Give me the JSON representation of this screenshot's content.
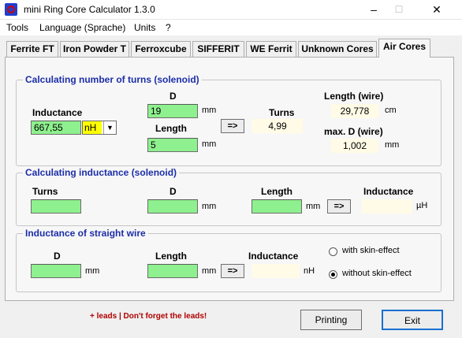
{
  "window": {
    "title": "mini Ring Core Calculator 1.3.0",
    "minimize": "–",
    "maximize": "☐",
    "close": "✕"
  },
  "menu": {
    "tools": "Tools",
    "language": "Language (Sprache)",
    "units": "Units",
    "help": "?"
  },
  "tabs": [
    {
      "label": "Ferrite FT"
    },
    {
      "label": "Iron Powder T"
    },
    {
      "label": "Ferroxcube"
    },
    {
      "label": "SIFFERIT"
    },
    {
      "label": "WE Ferrit"
    },
    {
      "label": "Unknown Cores"
    },
    {
      "label": "Air Cores",
      "active": true
    }
  ],
  "turns_group": {
    "title": "Calculating number of turns (solenoid)",
    "inductance_label": "Inductance",
    "inductance_value": "667,55",
    "unit_select": "nH",
    "d_label": "D",
    "d_value": "19",
    "d_unit": "mm",
    "length_label": "Length",
    "length_value": "5",
    "length_unit": "mm",
    "calc_button": "=>",
    "turns_label": "Turns",
    "turns_value": "4,99",
    "wire_length_label": "Length (wire)",
    "wire_length_value": "29,778",
    "wire_length_unit": "cm",
    "max_d_label": "max. D (wire)",
    "max_d_value": "1,002",
    "max_d_unit": "mm"
  },
  "inductance_group": {
    "title": "Calculating inductance (solenoid)",
    "turns_label": "Turns",
    "turns_value": "",
    "d_label": "D",
    "d_value": "",
    "d_unit": "mm",
    "length_label": "Length",
    "length_value": "",
    "length_unit": "mm",
    "calc_button": "=>",
    "inductance_label": "Inductance",
    "inductance_value": "",
    "inductance_unit": "µH"
  },
  "wire_group": {
    "title": "Inductance of straight wire",
    "d_label": "D",
    "d_value": "",
    "d_unit": "mm",
    "length_label": "Length",
    "length_value": "",
    "length_unit": "mm",
    "calc_button": "=>",
    "inductance_label": "Inductance",
    "inductance_value": "",
    "inductance_unit": "nH",
    "radio_with_skin": "with skin-effect",
    "radio_without_skin": "without skin-effect",
    "skin_effect_selected": "without"
  },
  "footer": {
    "note": "+ leads | Don't forget the leads!",
    "printing_button": "Printing",
    "exit_button": "Exit"
  },
  "colors": {
    "input_green": "#8ef08e",
    "output_yellow": "#fffbe6",
    "group_title_blue": "#1c2ea8",
    "note_red": "#b00000"
  }
}
